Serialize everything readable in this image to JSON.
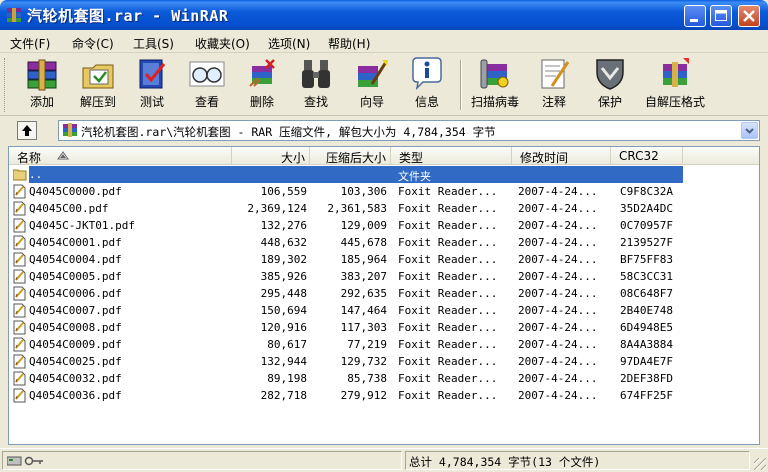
{
  "window": {
    "title": "汽轮机套图.rar - WinRAR"
  },
  "menu": [
    "文件(F)",
    "命令(C)",
    "工具(S)",
    "收藏夹(O)",
    "选项(N)",
    "帮助(H)"
  ],
  "toolbar": [
    {
      "label": "添加",
      "icon": "add-books-icon"
    },
    {
      "label": "解压到",
      "icon": "extract-folder-icon"
    },
    {
      "label": "测试",
      "icon": "test-book-icon"
    },
    {
      "label": "查看",
      "icon": "view-glasses-icon"
    },
    {
      "label": "删除",
      "icon": "delete-icon"
    },
    {
      "label": "查找",
      "icon": "find-binoculars-icon"
    },
    {
      "label": "向导",
      "icon": "wizard-icon"
    },
    {
      "label": "信息",
      "icon": "info-icon"
    },
    {
      "label": "扫描病毒",
      "icon": "virus-scan-icon"
    },
    {
      "label": "注释",
      "icon": "comment-icon"
    },
    {
      "label": "保护",
      "icon": "protect-shield-icon"
    },
    {
      "label": "自解压格式",
      "icon": "sfx-icon"
    }
  ],
  "address": {
    "path": "汽轮机套图.rar\\汽轮机套图 - RAR 压缩文件, 解包大小为 4,784,354 字节"
  },
  "columns": {
    "name": "名称",
    "size": "大小",
    "packed": "压缩后大小",
    "type": "类型",
    "modified": "修改时间",
    "crc": "CRC32"
  },
  "parent_row": {
    "name": "..",
    "type": "文件夹"
  },
  "files": [
    {
      "name": "Q4045C0000.pdf",
      "size": "106,559",
      "packed": "103,306",
      "type": "Foxit Reader...",
      "modified": "2007-4-24...",
      "crc": "C9F8C32A"
    },
    {
      "name": "Q4045C00.pdf",
      "size": "2,369,124",
      "packed": "2,361,583",
      "type": "Foxit Reader...",
      "modified": "2007-4-24...",
      "crc": "35D2A4DC"
    },
    {
      "name": "Q4045C-JKT01.pdf",
      "size": "132,276",
      "packed": "129,009",
      "type": "Foxit Reader...",
      "modified": "2007-4-24...",
      "crc": "0C70957F"
    },
    {
      "name": "Q4054C0001.pdf",
      "size": "448,632",
      "packed": "445,678",
      "type": "Foxit Reader...",
      "modified": "2007-4-24...",
      "crc": "2139527F"
    },
    {
      "name": "Q4054C0004.pdf",
      "size": "189,302",
      "packed": "185,964",
      "type": "Foxit Reader...",
      "modified": "2007-4-24...",
      "crc": "BF75FF83"
    },
    {
      "name": "Q4054C0005.pdf",
      "size": "385,926",
      "packed": "383,207",
      "type": "Foxit Reader...",
      "modified": "2007-4-24...",
      "crc": "58C3CC31"
    },
    {
      "name": "Q4054C0006.pdf",
      "size": "295,448",
      "packed": "292,635",
      "type": "Foxit Reader...",
      "modified": "2007-4-24...",
      "crc": "08C648F7"
    },
    {
      "name": "Q4054C0007.pdf",
      "size": "150,694",
      "packed": "147,464",
      "type": "Foxit Reader...",
      "modified": "2007-4-24...",
      "crc": "2B40E748"
    },
    {
      "name": "Q4054C0008.pdf",
      "size": "120,916",
      "packed": "117,303",
      "type": "Foxit Reader...",
      "modified": "2007-4-24...",
      "crc": "6D4948E5"
    },
    {
      "name": "Q4054C0009.pdf",
      "size": "80,617",
      "packed": "77,219",
      "type": "Foxit Reader...",
      "modified": "2007-4-24...",
      "crc": "8A4A3884"
    },
    {
      "name": "Q4054C0025.pdf",
      "size": "132,944",
      "packed": "129,732",
      "type": "Foxit Reader...",
      "modified": "2007-4-24...",
      "crc": "97DA4E7F"
    },
    {
      "name": "Q4054C0032.pdf",
      "size": "89,198",
      "packed": "85,738",
      "type": "Foxit Reader...",
      "modified": "2007-4-24...",
      "crc": "2DEF38FD"
    },
    {
      "name": "Q4054C0036.pdf",
      "size": "282,718",
      "packed": "279,912",
      "type": "Foxit Reader...",
      "modified": "2007-4-24...",
      "crc": "674FF25F"
    }
  ],
  "status": {
    "total": "总计 4,784,354 字节(13 个文件)"
  },
  "colors": {
    "title_blue": "#0550d0",
    "selection": "#316ac5",
    "face": "#ece9d8"
  }
}
